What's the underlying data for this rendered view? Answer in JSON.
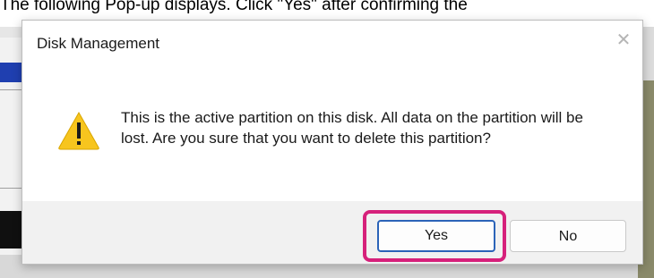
{
  "instruction": {
    "caption": "The following Pop-up displays. Click \"Yes\" after confirming the"
  },
  "dialog": {
    "title": "Disk Management",
    "close_icon": "close-icon",
    "warning_icon": "warning-icon",
    "message": "This is the active partition on this disk. All data on the partition will be lost. Are you sure that you want to delete this partition?",
    "yes_label": "Yes",
    "no_label": "No"
  },
  "colors": {
    "highlight": "#d6217b",
    "default_button_border": "#2b63b8",
    "warning_fill": "#f7c51e"
  }
}
